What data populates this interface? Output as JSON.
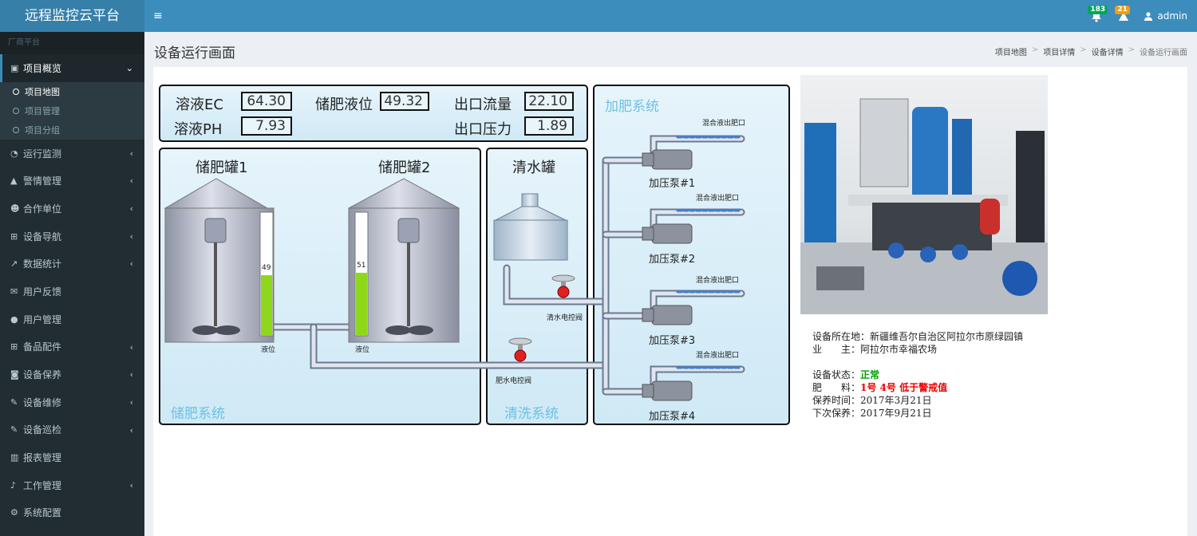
{
  "app": {
    "title": "远程监控云平台",
    "user": "admin",
    "notif_count": "183",
    "alert_count": "21"
  },
  "sidebar": {
    "header": "厂商平台",
    "items": [
      {
        "label": "项目概览",
        "icon": "map-icon"
      },
      {
        "label": "运行监测",
        "icon": "dashboard-icon"
      },
      {
        "label": "警情管理",
        "icon": "warning-icon"
      },
      {
        "label": "合作单位",
        "icon": "users-icon"
      },
      {
        "label": "设备导航",
        "icon": "sitemap-icon"
      },
      {
        "label": "数据统计",
        "icon": "chart-icon"
      },
      {
        "label": "用户反馈",
        "icon": "envelope-icon"
      },
      {
        "label": "用户管理",
        "icon": "user-icon"
      },
      {
        "label": "备品配件",
        "icon": "sitemap-icon"
      },
      {
        "label": "设备保养",
        "icon": "camera-icon"
      },
      {
        "label": "设备维修",
        "icon": "wrench-icon"
      },
      {
        "label": "设备巡检",
        "icon": "wrench-icon"
      },
      {
        "label": "报表管理",
        "icon": "bar-chart-icon"
      },
      {
        "label": "工作管理",
        "icon": "bell-icon"
      },
      {
        "label": "系统配置",
        "icon": "cogs-icon"
      }
    ],
    "sub_items": [
      {
        "label": "项目地图"
      },
      {
        "label": "项目管理"
      },
      {
        "label": "项目分组"
      }
    ]
  },
  "page": {
    "title": "设备运行画面"
  },
  "breadcrumb": [
    "项目地图",
    "项目详情",
    "设备详情",
    "设备运行画面"
  ],
  "readings": {
    "ec_label": "溶液EC",
    "ec_value": "64.30",
    "ph_label": "溶液PH",
    "ph_value": "7.93",
    "level_label": "储肥液位",
    "level_value": "49.32",
    "flow_label": "出口流量",
    "flow_value": "22.10",
    "pressure_label": "出口压力",
    "pressure_value": "1.89"
  },
  "tanks": {
    "tank1_label": "储肥罐1",
    "tank1_level": "49",
    "tank1_level_pct": 49,
    "tank2_label": "储肥罐2",
    "tank2_level": "51",
    "tank2_level_pct": 51,
    "level_caption": "液位",
    "water_tank_label": "清水罐",
    "water_valve": "清水电控阀",
    "fert_valve": "肥水电控阀"
  },
  "systems": {
    "storage": "储肥系统",
    "cleaning": "清洗系统",
    "fertilizing": "加肥系统"
  },
  "pumps": {
    "outlet": "混合液出肥口",
    "labels": [
      "加压泵#1",
      "加压泵#2",
      "加压泵#3",
      "加压泵#4"
    ]
  },
  "info": {
    "location_label": "设备所在地：",
    "location": "新疆维吾尔自治区阿拉尔市原绿园镇",
    "owner_label": "业　　主：",
    "owner": "阿拉尔市幸福农场",
    "status_label": "设备状态：",
    "status": "正常",
    "fert_label": "肥　　料：",
    "fert": "1号  4号  低于警戒值",
    "maint_label": "保养时间：",
    "maint": "2017年3月21日",
    "next_label": "下次保养：",
    "next": "2017年9月21日"
  },
  "colors": {
    "topbar": "#3c8dbc",
    "sidebar": "#222d32",
    "status_ok": "#00a000",
    "status_warn": "#ee0000",
    "level_fill": "#8ed81c"
  }
}
